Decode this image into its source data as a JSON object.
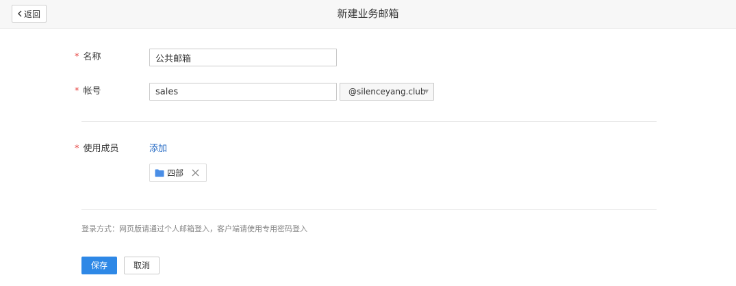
{
  "header": {
    "back_label": "返回",
    "title": "新建业务邮箱"
  },
  "form": {
    "required_mark": "*",
    "name": {
      "label": "名称",
      "value": "公共邮箱"
    },
    "account": {
      "label": "帐号",
      "value": "sales",
      "domain": "@silenceyang.club"
    },
    "members": {
      "label": "使用成员",
      "add_label": "添加",
      "tags": [
        {
          "label": "四部",
          "icon": "folder-icon"
        }
      ]
    },
    "login_hint": "登录方式：网页版请通过个人邮箱登入，客户端请使用专用密码登入"
  },
  "actions": {
    "save_label": "保存",
    "cancel_label": "取消"
  },
  "colors": {
    "accent": "#2e88e6",
    "link": "#1f66c2",
    "required": "#e64340",
    "folder": "#4a8ee6"
  }
}
